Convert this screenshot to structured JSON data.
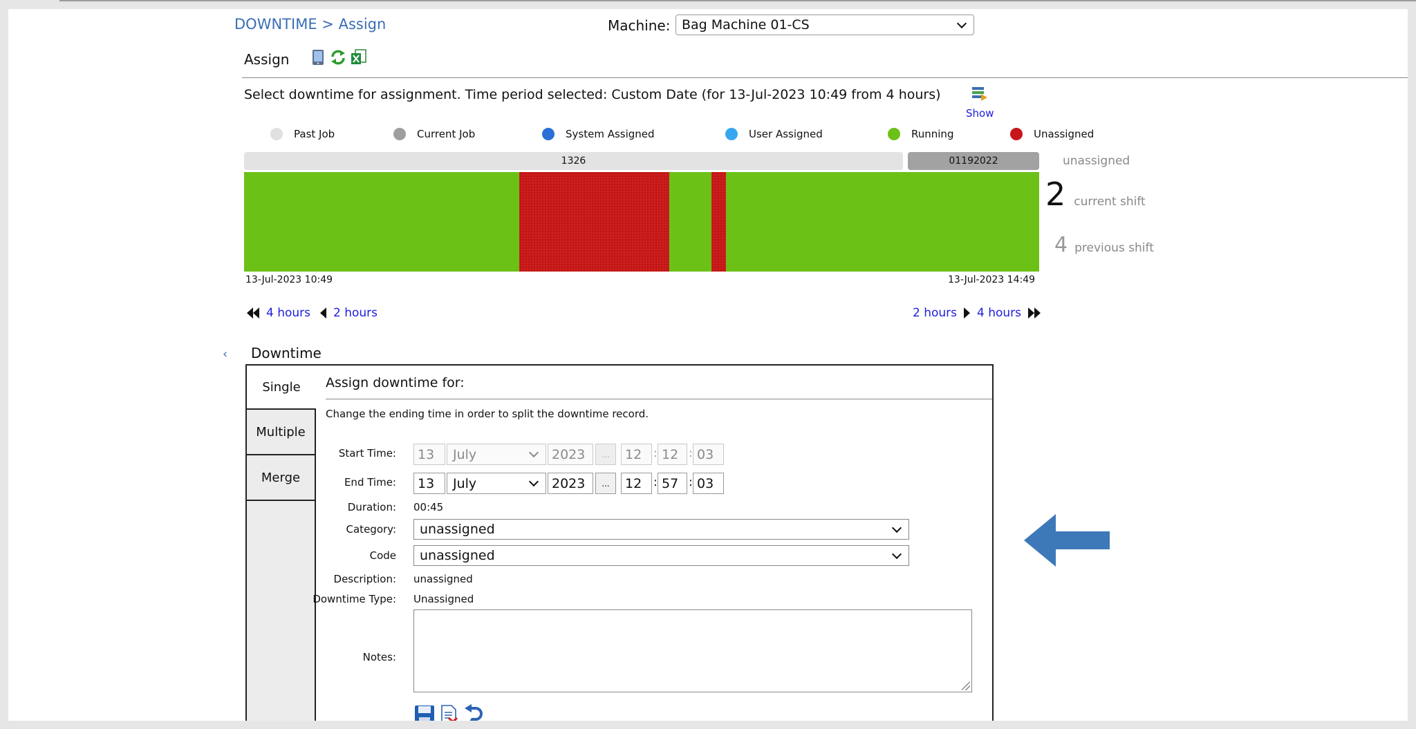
{
  "breadcrumb": {
    "root": "DOWNTIME",
    "separator": ">",
    "current": "Assign"
  },
  "machine": {
    "label": "Machine:",
    "value": "Bag Machine 01-CS"
  },
  "assign": {
    "title": "Assign",
    "toolbar_icons": [
      "tablet-icon",
      "refresh-icon",
      "excel-export-icon"
    ]
  },
  "instructions": "Select downtime for assignment. Time period selected: Custom Date (for 13-Jul-2023 10:49 from 4 hours)",
  "show": {
    "label": "Show",
    "icon": "show-list-icon"
  },
  "legend": [
    {
      "label": "Past Job",
      "color": "#e0e0e0"
    },
    {
      "label": "Current Job",
      "color": "#9e9e9e"
    },
    {
      "label": "System Assigned",
      "color": "#2a6fd6"
    },
    {
      "label": "User Assigned",
      "color": "#35a7f0"
    },
    {
      "label": "Running",
      "color": "#6cc117"
    },
    {
      "label": "Unassigned",
      "color": "#c8161d"
    }
  ],
  "jobs": {
    "past": "1326",
    "current": "01192022"
  },
  "shifts": {
    "unassigned_label": "unassigned",
    "current_count": "2",
    "current_label": "current shift",
    "previous_count": "4",
    "previous_label": "previous shift"
  },
  "timeline": {
    "start": "13-Jul-2023 10:49",
    "end": "13-Jul-2023 14:49"
  },
  "nav": {
    "back4": "4 hours",
    "back2": "2 hours",
    "fwd2": "2 hours",
    "fwd4": "4 hours"
  },
  "downtime": {
    "heading": "Downtime",
    "collapse_icon": "chevron-left-icon",
    "tabs": [
      "Single",
      "Multiple",
      "Merge"
    ],
    "assign_title": "Assign downtime for:",
    "split_note": "Change the ending time in order to split the downtime record.",
    "start": {
      "label": "Start Time:",
      "day": "13",
      "month": "July",
      "year": "2023",
      "btn": "...",
      "hh": "12",
      "mm": "12",
      "ss": "03"
    },
    "end": {
      "label": "End Time:",
      "day": "13",
      "month": "July",
      "year": "2023",
      "btn": "...",
      "hh": "12",
      "mm": "57",
      "ss": "03"
    },
    "duration": {
      "label": "Duration:",
      "value": "00:45"
    },
    "category": {
      "label": "Category:",
      "value": "unassigned"
    },
    "code": {
      "label": "Code",
      "value": "unassigned"
    },
    "description": {
      "label": "Description:",
      "value": "unassigned"
    },
    "type": {
      "label": "Downtime Type:",
      "value": "Unassigned"
    },
    "notes": {
      "label": "Notes:",
      "value": ""
    },
    "actions": [
      "save-icon",
      "delete-icon",
      "undo-icon"
    ]
  },
  "annotation_arrow": {
    "color": "#3d78b8",
    "icon": "left-arrow-icon"
  }
}
